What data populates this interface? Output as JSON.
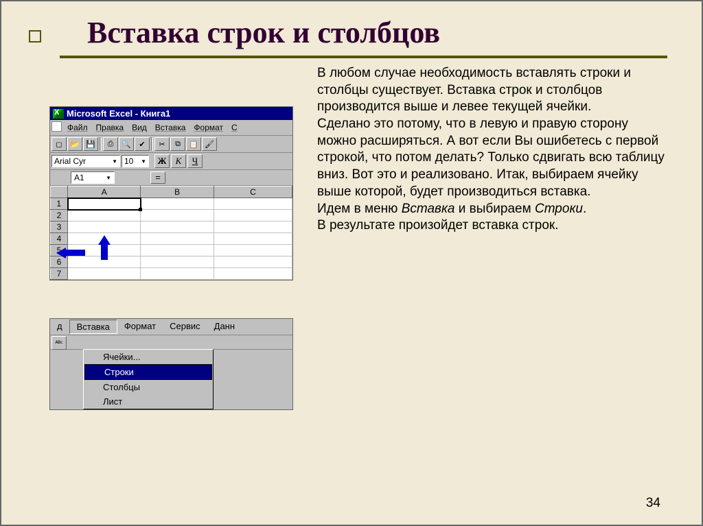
{
  "title": "Вставка строк и столбцов",
  "body_text": "В любом случае необходимость вставлять строки и столбцы существует. Вставка строк и столбцов производится выше и левее текущей ячейки.\nСделано это потому, что в левую и правую сторону можно расширяться. А вот если Вы ошибетесь с первой строкой, что потом делать? Только сдвигать всю таблицу вниз. Вот это и реализовано. Итак, выбираем ячейку выше которой, будет производиться вставка.",
  "body_text2_pre": "Идем в меню ",
  "body_text2_em1": "Вставка",
  "body_text2_mid": " и выбираем ",
  "body_text2_em2": "Строки",
  "body_text2_post": ".",
  "body_text3": "В результате произойдет вставка строк.",
  "excel": {
    "titlebar": "Microsoft Excel - Книга1",
    "menus": [
      "Файл",
      "Правка",
      "Вид",
      "Вставка",
      "Формат",
      "С"
    ],
    "font_name": "Arial Cyr",
    "font_size": "10",
    "style_b": "Ж",
    "style_i": "К",
    "style_u": "Ч",
    "cell_ref": "A1",
    "eq": "=",
    "cols": [
      "A",
      "B",
      "C"
    ],
    "rows": [
      "1",
      "2",
      "3",
      "4",
      "5",
      "6",
      "7"
    ]
  },
  "menu2": {
    "partial": "д",
    "items": [
      "Вставка",
      "Формат",
      "Сервис",
      "Данн"
    ],
    "dropdown": [
      "Ячейки...",
      "Строки",
      "Столбцы",
      "Лист"
    ],
    "highlighted": "Строки"
  },
  "page_number": "34"
}
